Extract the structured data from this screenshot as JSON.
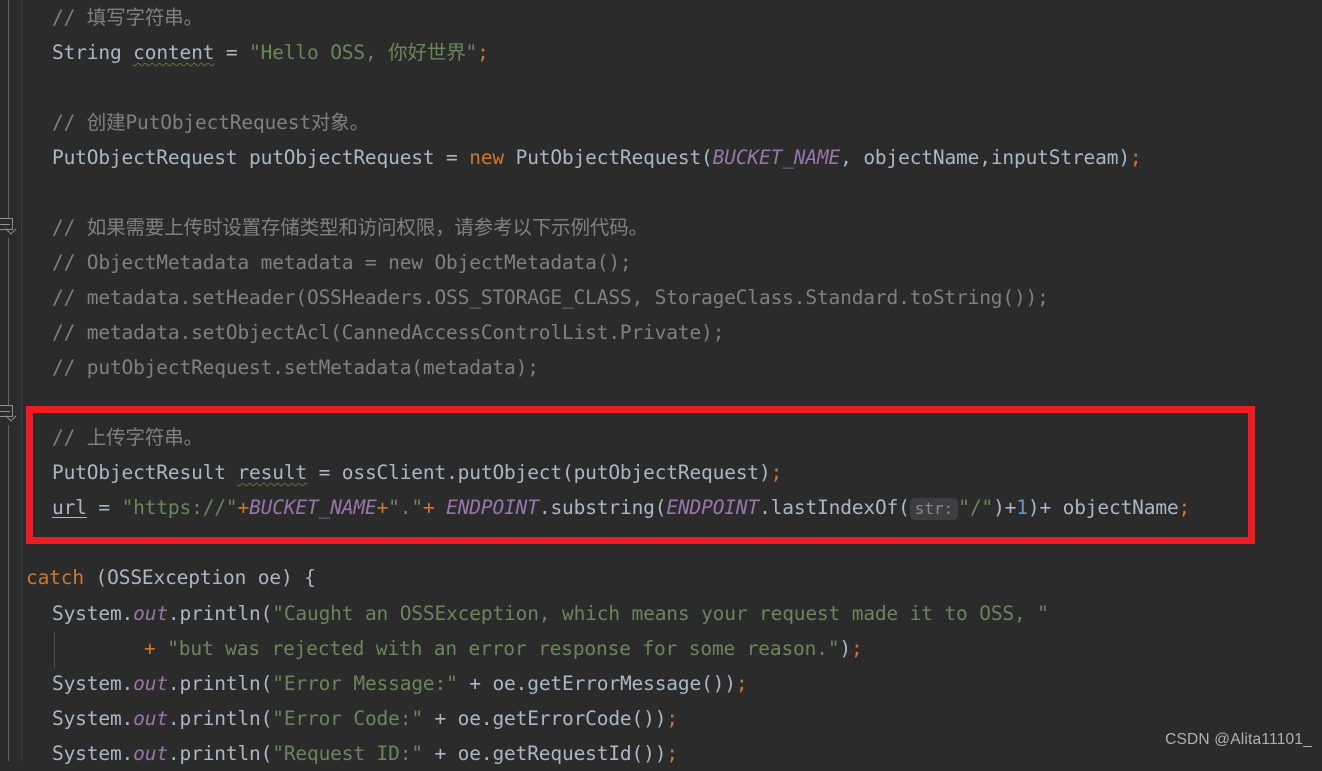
{
  "editor": {
    "theme": "darcula",
    "background_color": "#2b2b2b",
    "gutter_color": "#2b2b2b",
    "default_text_color": "#a9b7c6",
    "comment_color": "#808080",
    "string_color": "#6a8759",
    "keyword_color": "#cc7832",
    "number_color": "#6897bb",
    "static_field_color": "#9876aa",
    "annotation_box_color": "#ef1c25",
    "inlay_hint_background": "#3c3f41",
    "inlay_hint_color": "#8c8c8c"
  },
  "lines": {
    "l1_comment": "// 填写字符串。",
    "l2_type": "String ",
    "l2_var": "content",
    "l2_eq": " = ",
    "l2_str": "\"Hello OSS, 你好世界\"",
    "l2_semi": ";",
    "l4_comment": "// 创建PutObjectRequest对象。",
    "l5_type": "PutObjectRequest putObjectRequest = ",
    "l5_kw": "new",
    "l5_call": " PutObjectRequest(",
    "l5_arg1": "BUCKET_NAME",
    "l5_mid": ", objectName,inputStream",
    "l5_close": ")",
    "l5_semi": ";",
    "l7_comment": "// 如果需要上传时设置存储类型和访问权限，请参考以下示例代码。",
    "l8_comment": "// ObjectMetadata metadata = new ObjectMetadata();",
    "l9_comment": "// metadata.setHeader(OSSHeaders.OSS_STORAGE_CLASS, StorageClass.Standard.toString());",
    "l10_comment": "// metadata.setObjectAcl(CannedAccessControlList.Private);",
    "l11_comment": "// putObjectRequest.setMetadata(metadata);",
    "l13_comment": "// 上传字符串。",
    "l14_type": "PutObjectResult ",
    "l14_var": "result",
    "l14_rest": " = ossClient.putObject(putObjectRequest)",
    "l14_semi": ";",
    "l15_var": "url",
    "l15_eq": " = ",
    "l15_str1": "\"https://\"",
    "l15_plus1": "+",
    "l15_bucket": "BUCKET_NAME",
    "l15_plus2": "+",
    "l15_str2": "\".\"",
    "l15_plus3": "+ ",
    "l15_endpoint": "ENDPOINT",
    "l15_sub": ".substring(",
    "l15_endpoint2": "ENDPOINT",
    "l15_last": ".lastIndexOf(",
    "l15_hint": "str:",
    "l15_slash": "\"/\"",
    "l15_close1": ")+",
    "l15_one": "1",
    "l15_close2": ")+ objectName",
    "l15_semi": ";",
    "l17_kw": "catch",
    "l17_rest": " (OSSException oe) {",
    "l18_sys": "System.",
    "l18_out": "out",
    "l18_println": ".println(",
    "l18_str": "\"Caught an OSSException, which means your request made it to OSS, \"",
    "l19_plus": "+ ",
    "l19_str": "\"but was rejected with an error response for some reason.\"",
    "l19_close": ")",
    "l19_semi": ";",
    "l20_sys": "System.",
    "l20_out": "out",
    "l20_println": ".println(",
    "l20_str": "\"Error Message:\"",
    "l20_rest": " + oe.getErrorMessage()",
    "l20_close": ")",
    "l20_semi": ";",
    "l21_sys": "System.",
    "l21_out": "out",
    "l21_println": ".println(",
    "l21_str": "\"Error Code:\"",
    "l21_rest": " + oe.getErrorCode()",
    "l21_close": ")",
    "l21_semi": ";",
    "l22_sys": "System.",
    "l22_out": "out",
    "l22_println": ".println(",
    "l22_str": "\"Request ID:\"",
    "l22_rest": " + oe.getRequestId()",
    "l22_close": ")",
    "l22_semi": ";"
  },
  "annotation": {
    "type": "red-rectangle-highlight",
    "covers": "upload-string-block"
  },
  "watermark": {
    "text": "CSDN @Alita11101_"
  }
}
